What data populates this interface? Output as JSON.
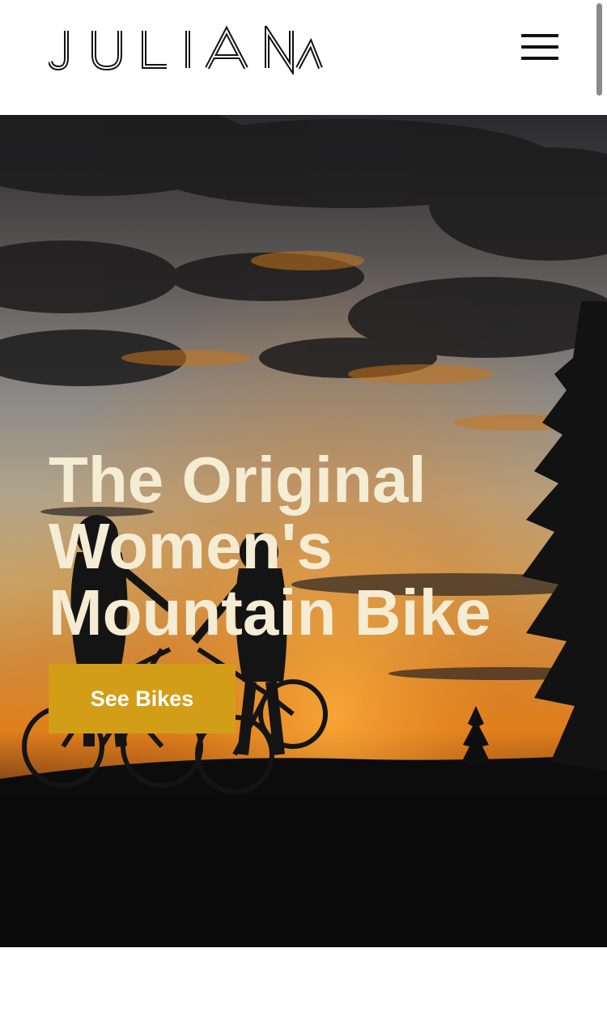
{
  "header": {
    "logo_text": "JULIANA",
    "menu_icon": "hamburger-menu-icon"
  },
  "hero": {
    "title_lines": [
      "The Original",
      "Women's",
      "Mountain Bike"
    ],
    "cta_label": "See Bikes",
    "image": "sunset-silhouette-two-cyclists"
  },
  "colors": {
    "title_text": "#f4ecd3",
    "cta_background": "#d39e17",
    "cta_text": "#ffffff",
    "header_background": "#ffffff"
  }
}
